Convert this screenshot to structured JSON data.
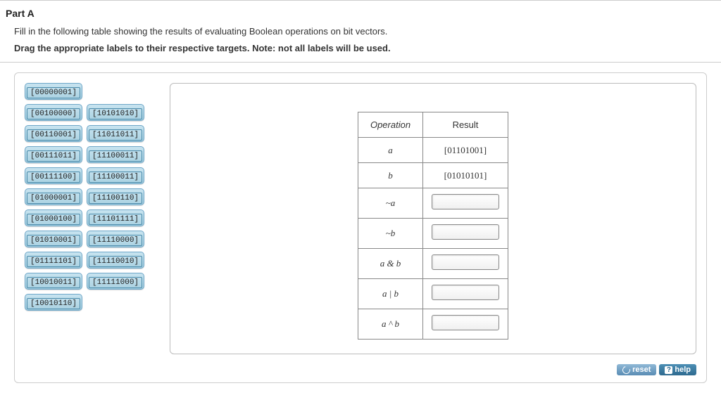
{
  "part_label": "Part A",
  "instructions_line1": "Fill in the following table showing the results of evaluating Boolean operations on bit vectors.",
  "instructions_line2": "Drag the appropriate labels to their respective targets. Note: not all labels will be used.",
  "draggable_labels": {
    "row0": [
      "[00000001]"
    ],
    "row1": [
      "[00100000]",
      "[10101010]"
    ],
    "row2": [
      "[00110001]",
      "[11011011]"
    ],
    "row3": [
      "[00111011]",
      "[11100011]"
    ],
    "row4": [
      "[00111100]",
      "[11100011]"
    ],
    "row5": [
      "[01000001]",
      "[11100110]"
    ],
    "row6": [
      "[01000100]",
      "[11101111]"
    ],
    "row7": [
      "[01010001]",
      "[11110000]"
    ],
    "row8": [
      "[01111101]",
      "[11110010]"
    ],
    "row9": [
      "[10010011]",
      "[11111000]"
    ],
    "row10": [
      "[10010110]"
    ]
  },
  "table": {
    "headers": {
      "op": "Operation",
      "res": "Result"
    },
    "rows": [
      {
        "op": "a",
        "result": "[01101001]",
        "has_target": false
      },
      {
        "op": "b",
        "result": "[01010101]",
        "has_target": false
      },
      {
        "op": "~a",
        "result": "",
        "has_target": true
      },
      {
        "op": "~b",
        "result": "",
        "has_target": true
      },
      {
        "op": "a & b",
        "result": "",
        "has_target": true
      },
      {
        "op": "a | b",
        "result": "",
        "has_target": true
      },
      {
        "op": "a ^ b",
        "result": "",
        "has_target": true
      }
    ]
  },
  "buttons": {
    "reset": "reset",
    "help": "help"
  }
}
